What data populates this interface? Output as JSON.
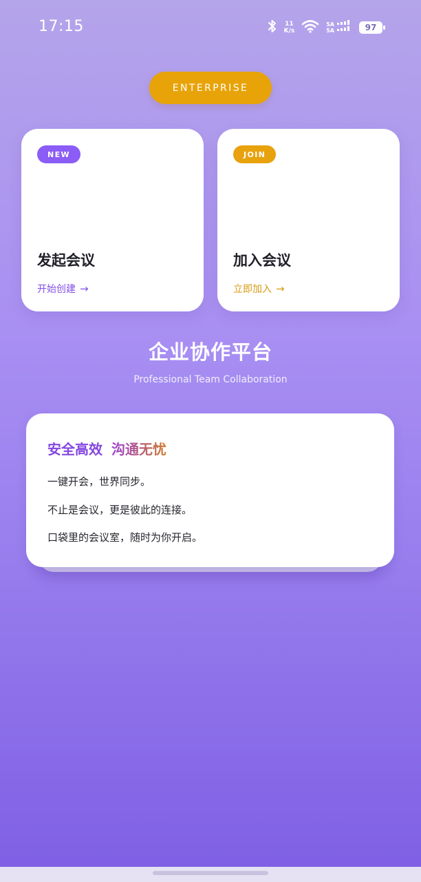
{
  "status_bar": {
    "time": "17:15",
    "net_speed_value": "11",
    "net_speed_unit": "K/s",
    "signal_label_top": "5A",
    "signal_label_bottom": "5A",
    "battery": "97",
    "icons": [
      "bluetooth-icon",
      "wifi-icon",
      "signal-icon",
      "battery-icon"
    ]
  },
  "header": {
    "pill_label": "ENTERPRISE"
  },
  "actions": [
    {
      "badge": "NEW",
      "title": "发起会议",
      "link": "开始创建",
      "accent": "#8b5cf6"
    },
    {
      "badge": "JOIN",
      "title": "加入会议",
      "link": "立即加入",
      "accent": "#e7a20d"
    }
  ],
  "arrow": "→",
  "platform": {
    "title": "企业协作平台",
    "subtitle": "Professional Team Collaboration"
  },
  "info": {
    "slogan_part1": "安全高效",
    "slogan_part2": "沟通无忧",
    "lines": [
      "一键开会，世界同步。",
      "不止是会议，更是彼此的连接。",
      "口袋里的会议室，随时为你开启。"
    ]
  },
  "colors": {
    "background_top": "#b4a4ea",
    "background_bottom": "#7e5fe4",
    "accent_purple": "#8b5cf6",
    "accent_amber": "#e8a308"
  }
}
